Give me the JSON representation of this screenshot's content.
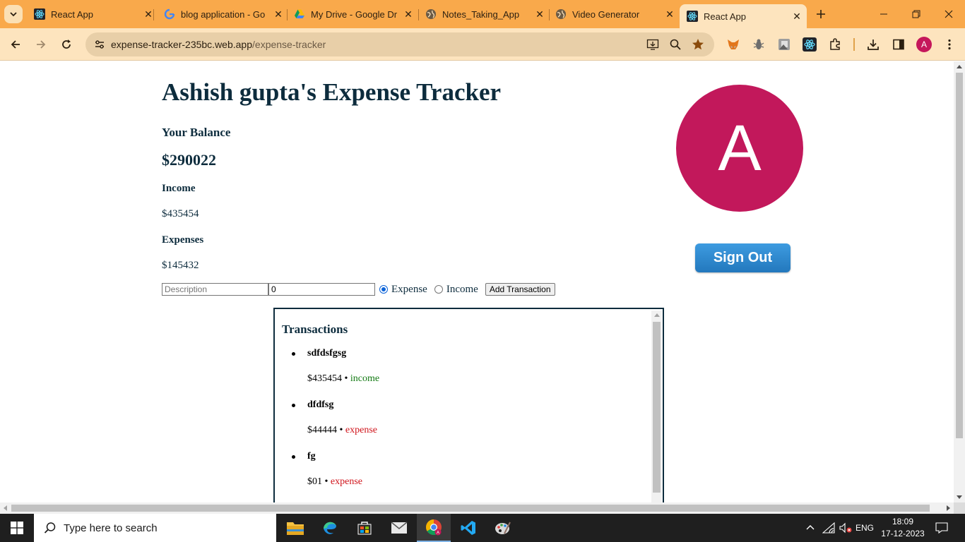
{
  "browser": {
    "tabs": [
      {
        "title": "React App",
        "icon": "react-icon"
      },
      {
        "title": "blog application - Go",
        "icon": "google-icon"
      },
      {
        "title": "My Drive - Google Dr",
        "icon": "google-drive-icon"
      },
      {
        "title": "Notes_Taking_App",
        "icon": "globe-icon"
      },
      {
        "title": "Video Generator",
        "icon": "globe-icon"
      },
      {
        "title": "React App",
        "icon": "react-icon",
        "active": true
      }
    ],
    "close_glyph": "✕",
    "address": {
      "domain": "expense-tracker-235bc.web.app",
      "path": "/expense-tracker"
    },
    "profile_initial": "A",
    "theme_color": "#f9a94b"
  },
  "app": {
    "title": "Ashish gupta's Expense Tracker",
    "balance_label": "Your Balance",
    "balance_value": "$290022",
    "income_label": "Income",
    "income_value": "$435454",
    "expenses_label": "Expenses",
    "expenses_value": "$145432",
    "form": {
      "description_placeholder": "Description",
      "amount_value": "0",
      "type_options": [
        "Expense",
        "Income"
      ],
      "selected_type": "Expense",
      "add_button": "Add Transaction"
    },
    "avatar_initial": "A",
    "avatar_color": "#c2185b",
    "sign_out": "Sign Out",
    "transactions_title": "Transactions",
    "transactions": [
      {
        "name": "sdfdsfgsg",
        "amount": "$435454",
        "sep": "•",
        "type": "income"
      },
      {
        "name": "dfdfsg",
        "amount": "$44444",
        "sep": "•",
        "type": "expense"
      },
      {
        "name": "fg",
        "amount": "$01",
        "sep": "•",
        "type": "expense"
      }
    ]
  },
  "taskbar": {
    "search_placeholder": "Type here to search",
    "language": "ENG",
    "time": "18:09",
    "date": "17-12-2023"
  }
}
